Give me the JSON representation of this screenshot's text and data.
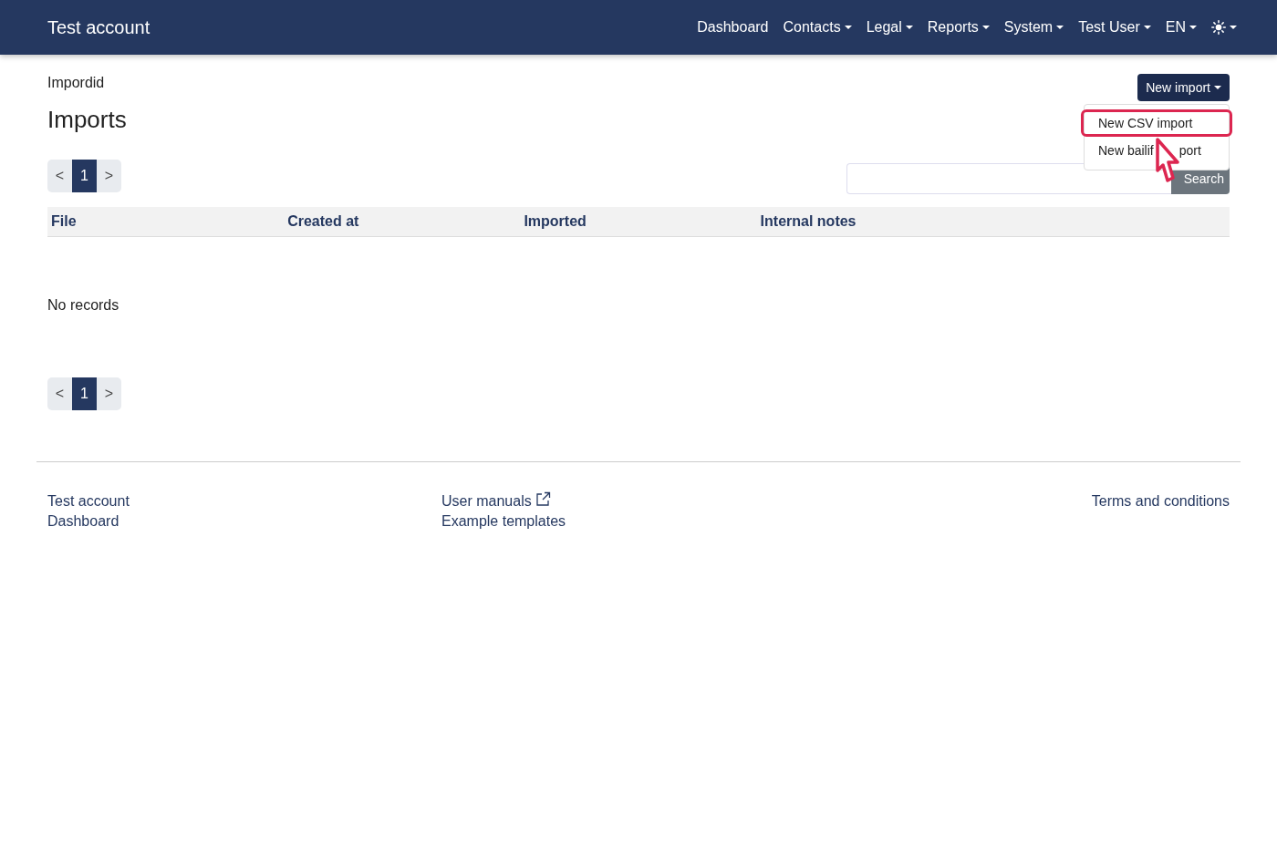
{
  "navbar": {
    "brand": "Test account",
    "items": [
      {
        "label": "Dashboard",
        "dropdown": false
      },
      {
        "label": "Contacts",
        "dropdown": true
      },
      {
        "label": "Legal",
        "dropdown": true
      },
      {
        "label": "Reports",
        "dropdown": true
      },
      {
        "label": "System",
        "dropdown": true
      },
      {
        "label": "Test User",
        "dropdown": true
      },
      {
        "label": "EN",
        "dropdown": true
      }
    ]
  },
  "breadcrumb": "Impordid",
  "title": "Imports",
  "new_import": {
    "label": "New import",
    "menu": [
      {
        "label": "New CSV import",
        "highlighted": true
      },
      {
        "label": "New bailif",
        "label_end": "port",
        "highlighted": false
      }
    ]
  },
  "pagination_top": {
    "prev": "<",
    "pages": [
      {
        "label": "1",
        "selected": true
      }
    ],
    "next": ">"
  },
  "search": {
    "button": "Search"
  },
  "table": {
    "columns": [
      "File",
      "Created at",
      "Imported",
      "Internal notes"
    ],
    "empty": "No records"
  },
  "pagination_bottom": {
    "prev": "<",
    "pages": [
      {
        "label": "1",
        "selected": true
      }
    ],
    "next": ">"
  },
  "footer": {
    "left": [
      "Test account",
      "Dashboard"
    ],
    "middle": [
      {
        "label": "User manuals",
        "external": true
      },
      {
        "label": "Example templates",
        "external": false
      }
    ],
    "right": [
      "Terms and conditions"
    ]
  }
}
